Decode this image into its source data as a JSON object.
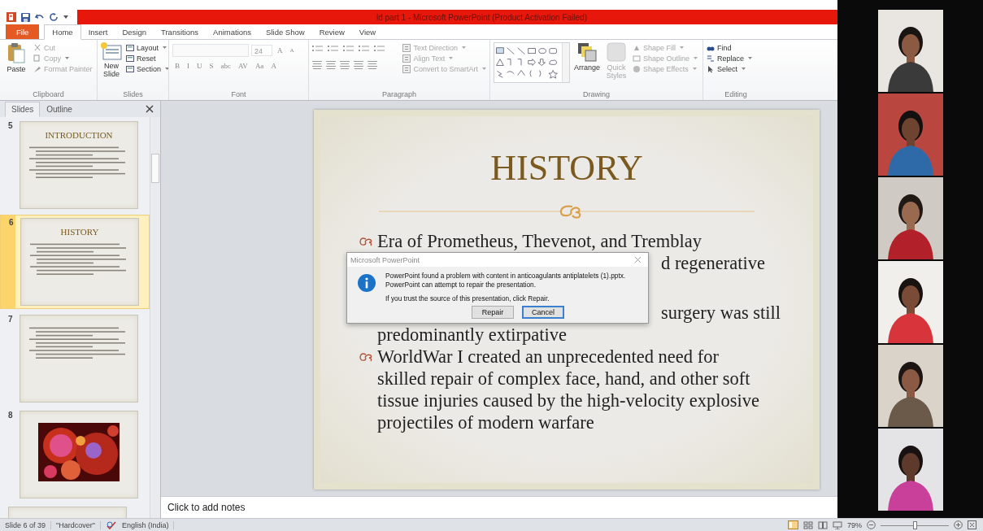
{
  "title_bar": {
    "title": "ld part 1 - Microsoft PowerPoint (Product Activation Failed)"
  },
  "tabs": [
    {
      "label": "File",
      "kind": "file",
      "selected": false
    },
    {
      "label": "Home",
      "kind": "tab",
      "selected": true
    },
    {
      "label": "Insert",
      "kind": "tab",
      "selected": false
    },
    {
      "label": "Design",
      "kind": "tab",
      "selected": false
    },
    {
      "label": "Transitions",
      "kind": "tab",
      "selected": false
    },
    {
      "label": "Animations",
      "kind": "tab",
      "selected": false
    },
    {
      "label": "Slide Show",
      "kind": "tab",
      "selected": false
    },
    {
      "label": "Review",
      "kind": "tab",
      "selected": false
    },
    {
      "label": "View",
      "kind": "tab",
      "selected": false
    }
  ],
  "ribbon": {
    "clipboard": {
      "label": "Clipboard",
      "paste": {
        "label": "Paste",
        "disabled": false
      },
      "items": [
        {
          "label": "Cut",
          "disabled": true,
          "menu": false
        },
        {
          "label": "Copy",
          "disabled": true,
          "menu": true
        },
        {
          "label": "Format Painter",
          "disabled": true,
          "menu": false
        }
      ]
    },
    "slides": {
      "label": "Slides",
      "new_slide": {
        "label": "New Slide",
        "disabled": false
      },
      "items": [
        {
          "label": "Layout",
          "disabled": false,
          "menu": true
        },
        {
          "label": "Reset",
          "disabled": false,
          "menu": false
        },
        {
          "label": "Section",
          "disabled": false,
          "menu": true
        }
      ]
    },
    "font": {
      "label": "Font",
      "size": "24",
      "size_buttons": [
        "A",
        "A"
      ],
      "format_buttons": [
        "B",
        "I",
        "U",
        "S",
        "abc",
        "AV",
        "Aa",
        "A"
      ]
    },
    "paragraph": {
      "label": "Paragraph",
      "items": [
        {
          "label": "Text Direction",
          "disabled": true,
          "menu": true
        },
        {
          "label": "Align Text",
          "disabled": true,
          "menu": true
        },
        {
          "label": "Convert to SmartArt",
          "disabled": true,
          "menu": true
        }
      ]
    },
    "drawing": {
      "label": "Drawing",
      "arrange": {
        "label": "Arrange",
        "disabled": false
      },
      "quick_styles": {
        "label": "Quick Styles",
        "disabled": true
      },
      "items": [
        {
          "label": "Shape Fill",
          "disabled": true,
          "menu": true
        },
        {
          "label": "Shape Outline",
          "disabled": true,
          "menu": true
        },
        {
          "label": "Shape Effects",
          "disabled": true,
          "menu": true
        }
      ]
    },
    "editing": {
      "label": "Editing",
      "items": [
        {
          "label": "Find",
          "disabled": false,
          "menu": false
        },
        {
          "label": "Replace",
          "disabled": false,
          "menu": true
        },
        {
          "label": "Select",
          "disabled": false,
          "menu": true
        }
      ]
    }
  },
  "pane_tabs": [
    {
      "label": "Slides",
      "selected": true
    },
    {
      "label": "Outline",
      "selected": false
    }
  ],
  "thumbnails": [
    {
      "number": "5",
      "title": "INTRODUCTION",
      "kind": "text",
      "selected": false
    },
    {
      "number": "6",
      "title": "HISTORY",
      "kind": "text",
      "selected": true
    },
    {
      "number": "7",
      "kind": "text",
      "selected": false
    },
    {
      "number": "8",
      "kind": "picture",
      "selected": false
    },
    {
      "kind": "blank",
      "selected": false
    }
  ],
  "slide": {
    "title": "HISTORY",
    "lines": [
      {
        "kind": "bullet",
        "text": "Era of Prometheus, Thevenot, and Tremblay"
      },
      {
        "kind": "fragment",
        "text": "d regenerative"
      },
      {
        "kind": "fragment",
        "text": "surgery was still"
      },
      {
        "kind": "continuation",
        "text": "predominantly extirpative"
      },
      {
        "kind": "bullet",
        "text": "WorldWar I created an unprecedented need for"
      },
      {
        "kind": "continuation",
        "text": "skilled repair of complex face, hand, and other soft"
      },
      {
        "kind": "continuation",
        "text": "tissue injuries caused by the high-velocity explosive"
      },
      {
        "kind": "continuation",
        "text": "projectiles of modern warfare"
      }
    ]
  },
  "dialog": {
    "title": "Microsoft PowerPoint",
    "messages": [
      "PowerPoint found a problem with content in anticoagulants antiplatelets (1).pptx.",
      "PowerPoint can attempt to repair the presentation.",
      "If you trust the source of this presentation, click Repair."
    ],
    "buttons": [
      {
        "label": "Repair",
        "focused": false
      },
      {
        "label": "Cancel",
        "focused": true
      }
    ]
  },
  "notes": {
    "placeholder": "Click to add notes"
  },
  "status_bar": {
    "slide": "Slide 6 of 39",
    "theme": "\"Hardcover\"",
    "language": "English (India)",
    "zoom": "79%",
    "zoom_slider": {
      "level": 0.5
    }
  }
}
